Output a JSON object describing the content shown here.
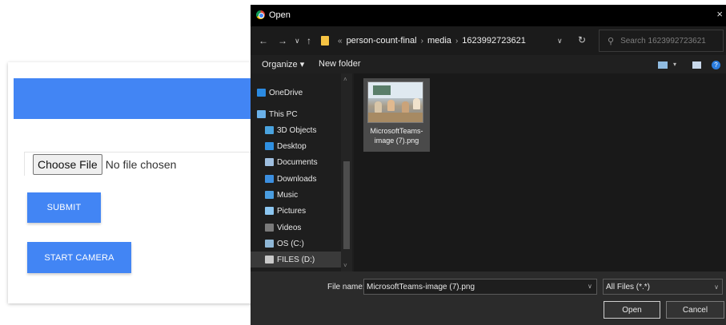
{
  "page": {
    "choose_file_label": "Choose File",
    "file_status": "No file chosen",
    "submit_label": "SUBMIT",
    "start_camera_label": "START CAMERA",
    "accent_color": "#4285f4"
  },
  "dialog": {
    "title": "Open",
    "close_glyph": "×",
    "nav": {
      "back": "←",
      "forward": "→",
      "recent": "∨",
      "up": "↑"
    },
    "breadcrumb": [
      "person-count-final",
      "media",
      "1623992723621"
    ],
    "breadcrumb_prefix": "«",
    "search_placeholder": "Search 1623992723621",
    "toolbar": {
      "organize": "Organize ▾",
      "new_folder": "New folder"
    },
    "sidebar": [
      {
        "label": "OneDrive",
        "icon": "cloud-icon",
        "color": "#2b8ae2"
      },
      {
        "label": "This PC",
        "icon": "computer-icon",
        "color": "#6ab0e8"
      },
      {
        "label": "3D Objects",
        "icon": "cube-icon",
        "color": "#4aa3df"
      },
      {
        "label": "Desktop",
        "icon": "desktop-icon",
        "color": "#2f8fe0"
      },
      {
        "label": "Documents",
        "icon": "document-icon",
        "color": "#9fbfe0"
      },
      {
        "label": "Downloads",
        "icon": "download-icon",
        "color": "#3c8fe0"
      },
      {
        "label": "Music",
        "icon": "music-icon",
        "color": "#4a9de0"
      },
      {
        "label": "Pictures",
        "icon": "pictures-icon",
        "color": "#8cc6f0"
      },
      {
        "label": "Videos",
        "icon": "videos-icon",
        "color": "#7a7a7a"
      },
      {
        "label": "OS (C:)",
        "icon": "drive-icon",
        "color": "#8fb7d6"
      },
      {
        "label": "FILES (D:)",
        "icon": "drive-icon",
        "color": "#c9c9c9"
      }
    ],
    "file": {
      "name": "MicrosoftTeams-image (7).png"
    },
    "file_name_label": "File name:",
    "file_name_value": "MicrosoftTeams-image (7).png",
    "filter_value": "All Files (*.*)",
    "open_label": "Open",
    "cancel_label": "Cancel"
  }
}
